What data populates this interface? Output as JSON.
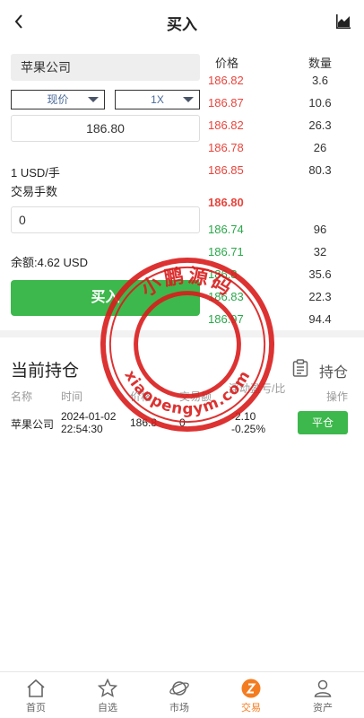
{
  "header": {
    "title": "买入"
  },
  "order": {
    "stock_name": "苹果公司",
    "order_type": "现价",
    "leverage": "1X",
    "price": "186.80",
    "unit": "1 USD/手",
    "lots_label": "交易手数",
    "quantity": "0",
    "balance": "余额:4.62 USD",
    "buy_label": "买入"
  },
  "orderbook": {
    "price_header": "价格",
    "qty_header": "数量",
    "asks": [
      {
        "price": "186.82",
        "qty": "3.6"
      },
      {
        "price": "186.87",
        "qty": "10.6"
      },
      {
        "price": "186.82",
        "qty": "26.3"
      },
      {
        "price": "186.78",
        "qty": "26"
      },
      {
        "price": "186.85",
        "qty": "80.3"
      }
    ],
    "current": "186.80",
    "bids": [
      {
        "price": "186.74",
        "qty": "96"
      },
      {
        "price": "186.71",
        "qty": "32"
      },
      {
        "price": "186.8",
        "qty": "35.6"
      },
      {
        "price": "186.83",
        "qty": "22.3"
      },
      {
        "price": "186.97",
        "qty": "94.4"
      }
    ]
  },
  "positions": {
    "title": "当前持仓",
    "tab_label": "持仓",
    "columns": [
      "名称",
      "时间",
      "价格",
      "交易额",
      "浮动盈亏/比",
      "操作"
    ],
    "rows": [
      {
        "name": "苹果公司",
        "date": "2024-01-02",
        "time": "22:54:30",
        "price": "186.8",
        "amount": "0",
        "pnl": "-2.10",
        "pnl_pct": "-0.25%",
        "action": "平仓"
      }
    ]
  },
  "watermark": {
    "top_text": "小鹏源码",
    "bottom_text": "xiaopengym.com"
  },
  "tabbar": {
    "items": [
      {
        "label": "首页",
        "icon": "home-icon"
      },
      {
        "label": "自选",
        "icon": "star-icon"
      },
      {
        "label": "市场",
        "icon": "planet-icon"
      },
      {
        "label": "交易",
        "icon": "trade-icon",
        "active": true
      },
      {
        "label": "资产",
        "icon": "user-icon"
      }
    ]
  },
  "colors": {
    "up": "#e8453c",
    "down": "#2aa84a",
    "primary": "#3cb84c",
    "active_tab": "#f47c20",
    "stamp": "#d91c1c"
  }
}
